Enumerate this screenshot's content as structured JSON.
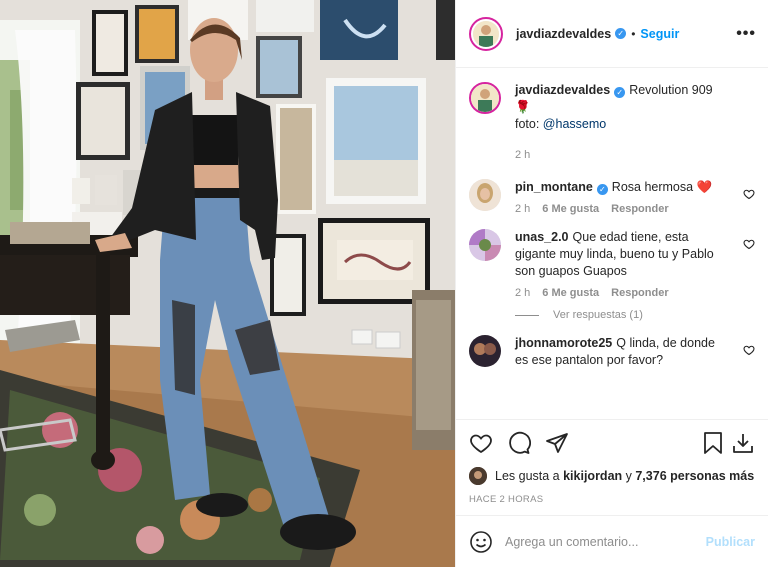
{
  "post": {
    "author": "javdiazdevaldes",
    "follow_label": "Seguir",
    "more_label": "•••",
    "separator": "•"
  },
  "colors": {
    "accent": "#0095f6",
    "verified": "#3897f0",
    "muted": "#8e8e8e",
    "text": "#262626",
    "heart_red": "#ed4956"
  },
  "caption": {
    "username": "javdiazdevaldes",
    "text": "Revolution 909 🌹",
    "foto_prefix": "foto: ",
    "mention": "@hassemo",
    "time": "2 h"
  },
  "comments": [
    {
      "username": "pin_montane",
      "verified": true,
      "text": "Rosa hermosa ❤️",
      "time": "2 h",
      "likes": "6 Me gusta",
      "reply": "Responder"
    },
    {
      "username": "unas_2.0",
      "verified": false,
      "text": "Que edad tiene, esta gigante muy linda, bueno tu y Pablo son guapos Guapos",
      "time": "2 h",
      "likes": "6 Me gusta",
      "reply": "Responder",
      "view_replies": "Ver respuestas (1)"
    },
    {
      "username": "jhonnamorote25",
      "verified": false,
      "text": "Q linda, de donde es ese pantalon por favor?"
    }
  ],
  "likes_line": {
    "prefix": "Les gusta a ",
    "user": "kikijordan",
    "middle": " y ",
    "count": "7,376 personas más"
  },
  "time_ago": "HACE 2 HORAS",
  "add_comment": {
    "placeholder": "Agrega un comentario...",
    "publish_label": "Publicar"
  },
  "icons": {
    "like": "heart-outline-icon",
    "comment": "comment-bubble-icon",
    "share": "paper-plane-icon",
    "save": "bookmark-icon",
    "download": "download-icon",
    "emoji": "smiley-icon"
  }
}
